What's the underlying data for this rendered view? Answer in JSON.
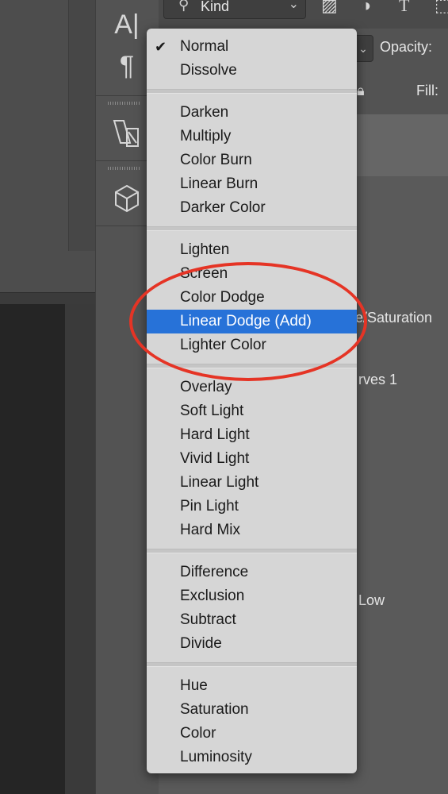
{
  "toolbar": {
    "kind_label": "Kind",
    "opacity_label": "Opacity:",
    "fill_label": "Fill:"
  },
  "tools": {
    "type_icon": "A|",
    "paragraph_icon": "¶"
  },
  "layers": {
    "hue_saturation_partial": "e/Saturation",
    "curves_partial": "rves 1",
    "low_partial": "Low"
  },
  "blend_menu": {
    "selected": "Linear Dodge (Add)",
    "groups": [
      [
        "Normal",
        "Dissolve"
      ],
      [
        "Darken",
        "Multiply",
        "Color Burn",
        "Linear Burn",
        "Darker Color"
      ],
      [
        "Lighten",
        "Screen",
        "Color Dodge",
        "Linear Dodge (Add)",
        "Lighter Color"
      ],
      [
        "Overlay",
        "Soft Light",
        "Hard Light",
        "Vivid Light",
        "Linear Light",
        "Pin Light",
        "Hard Mix"
      ],
      [
        "Difference",
        "Exclusion",
        "Subtract",
        "Divide"
      ],
      [
        "Hue",
        "Saturation",
        "Color",
        "Luminosity"
      ]
    ],
    "checked_item": "Normal"
  },
  "colors": {
    "highlight": "#2772d8",
    "annotation": "#e53425",
    "menu_bg": "#d6d6d6",
    "panel_bg": "#535353"
  },
  "icons": {
    "check": "check-icon",
    "search": "search-icon",
    "lock": "lock-icon"
  }
}
